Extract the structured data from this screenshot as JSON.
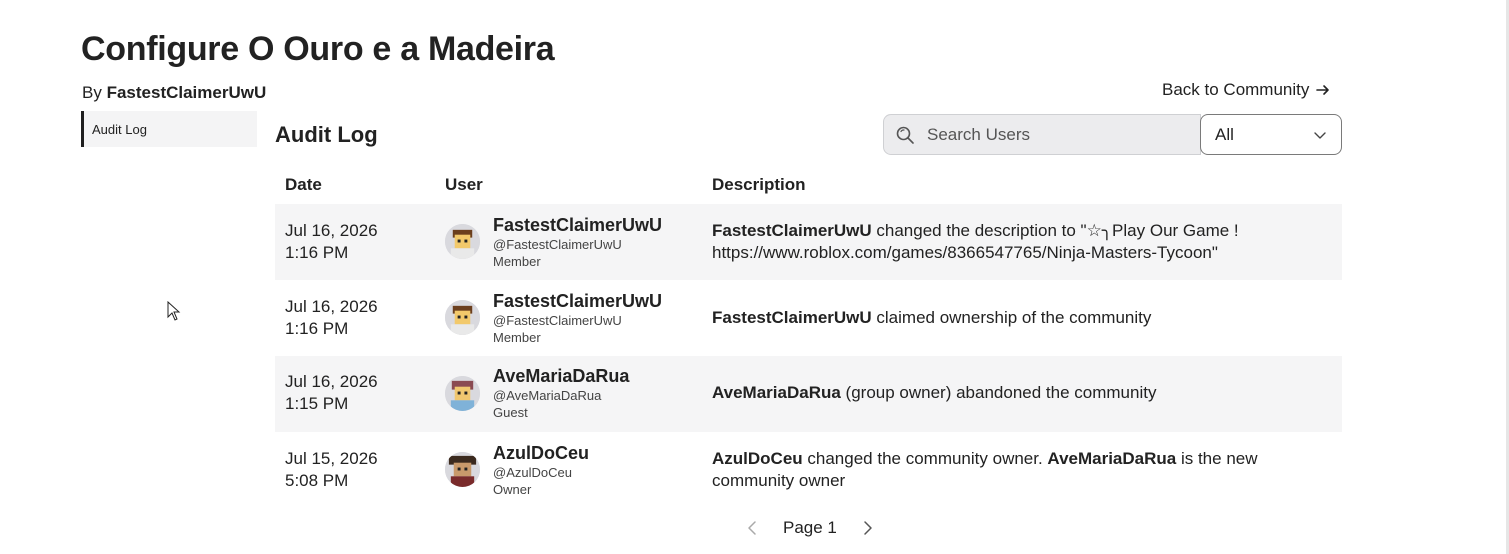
{
  "page": {
    "title": "Configure O Ouro e a Madeira",
    "by_prefix": "By",
    "owner": "FastestClaimerUwU",
    "back_link": "Back to Community"
  },
  "sidebar": {
    "items": [
      {
        "label": "Audit Log",
        "active": true
      }
    ]
  },
  "audit": {
    "section_title": "Audit Log",
    "search_placeholder": "Search Users",
    "filter_value": "All",
    "columns": {
      "date": "Date",
      "user": "User",
      "description": "Description"
    },
    "rows": [
      {
        "date": "Jul 16, 2026",
        "time": "1:16 PM",
        "name": "FastestClaimerUwU",
        "handle": "@FastestClaimerUwU",
        "role": "Member",
        "desc_actor": "FastestClaimerUwU",
        "desc_text": " changed the description to \"☆╮Play Our Game ! https://www.roblox.com/games/8366547765/Ninja-Masters-Tycoon\""
      },
      {
        "date": "Jul 16, 2026",
        "time": "1:16 PM",
        "name": "FastestClaimerUwU",
        "handle": "@FastestClaimerUwU",
        "role": "Member",
        "desc_actor": "FastestClaimerUwU",
        "desc_text": " claimed ownership of the community"
      },
      {
        "date": "Jul 16, 2026",
        "time": "1:15 PM",
        "name": "AveMariaDaRua",
        "handle": "@AveMariaDaRua",
        "role": "Guest",
        "desc_actor": "AveMariaDaRua",
        "desc_text": " (group owner) abandoned the community"
      },
      {
        "date": "Jul 15, 2026",
        "time": "5:08 PM",
        "name": "AzulDoCeu",
        "handle": "@AzulDoCeu",
        "role": "Owner",
        "desc_actor": "AzulDoCeu",
        "desc_text": " changed the community owner. ",
        "desc_actor2": "AveMariaDaRua",
        "desc_text2": " is the new community owner"
      }
    ]
  },
  "pagination": {
    "label": "Page 1"
  },
  "colors": {
    "row_shade": "#f5f5f6",
    "text": "#222222",
    "search_bg": "#ececee"
  },
  "icons": {
    "search": "search-icon",
    "dropdown": "chevron-down-icon",
    "back": "arrow-right-icon",
    "prev": "chevron-left-icon",
    "next": "chevron-right-icon"
  }
}
